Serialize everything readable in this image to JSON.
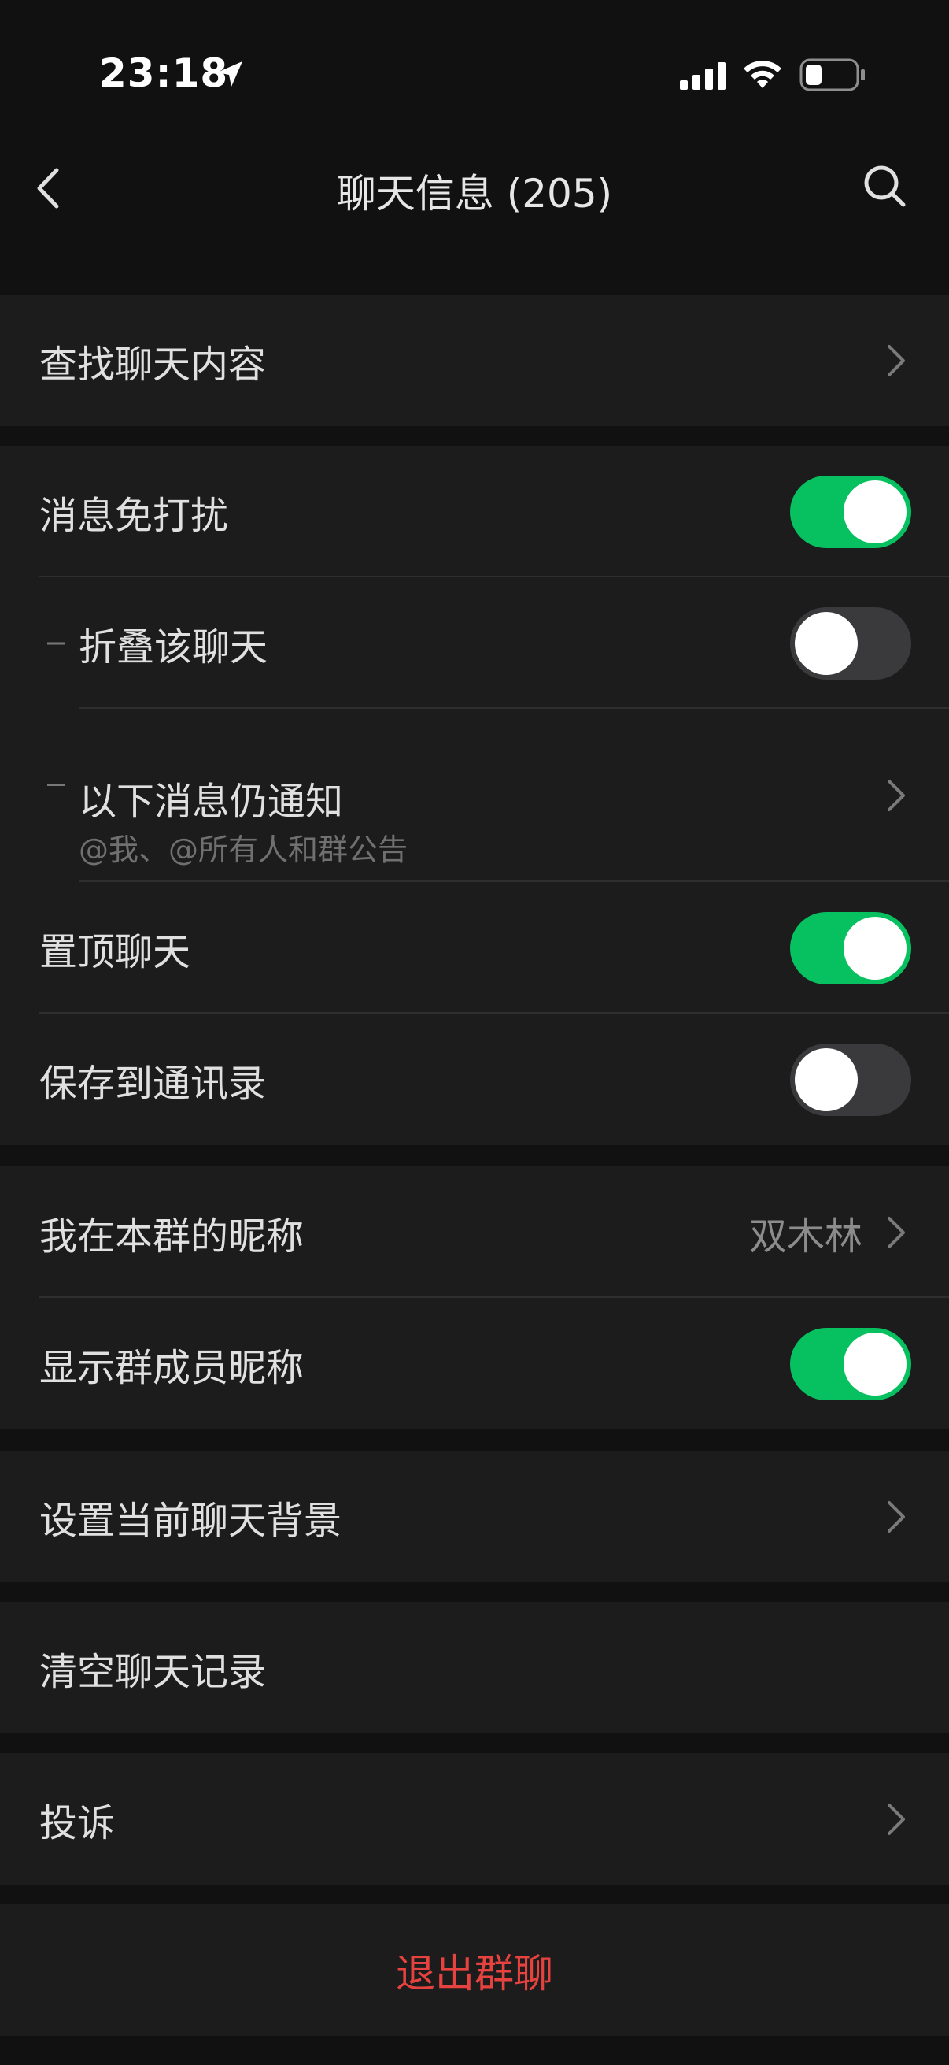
{
  "status_bar": {
    "time": "23:18",
    "location_icon": "location-arrow-icon",
    "signal_icon": "cellular-signal-icon",
    "wifi_icon": "wifi-icon",
    "battery_icon": "battery-icon"
  },
  "nav": {
    "title": "聊天信息 (205)",
    "back_icon": "chevron-left-icon",
    "search_icon": "search-icon"
  },
  "colors": {
    "toggle_on": "#07c160",
    "toggle_off": "#3a3a3c",
    "danger": "#e64340"
  },
  "groups": {
    "find": {
      "label": "查找聊天内容"
    },
    "notify": {
      "mute_label": "消息免打扰",
      "mute_on": true,
      "fold_label": "折叠该聊天",
      "fold_on": false,
      "still_notify_label": "以下消息仍通知",
      "still_notify_sub": "@我、@所有人和群公告",
      "pin_label": "置顶聊天",
      "pin_on": true,
      "save_label": "保存到通讯录",
      "save_on": false
    },
    "nickname": {
      "my_nick_label": "我在本群的昵称",
      "my_nick_value": "双木林",
      "show_nick_label": "显示群成员昵称",
      "show_nick_on": true
    },
    "background": {
      "label": "设置当前聊天背景"
    },
    "clear": {
      "label": "清空聊天记录"
    },
    "report": {
      "label": "投诉"
    },
    "exit": {
      "label": "退出群聊"
    }
  }
}
